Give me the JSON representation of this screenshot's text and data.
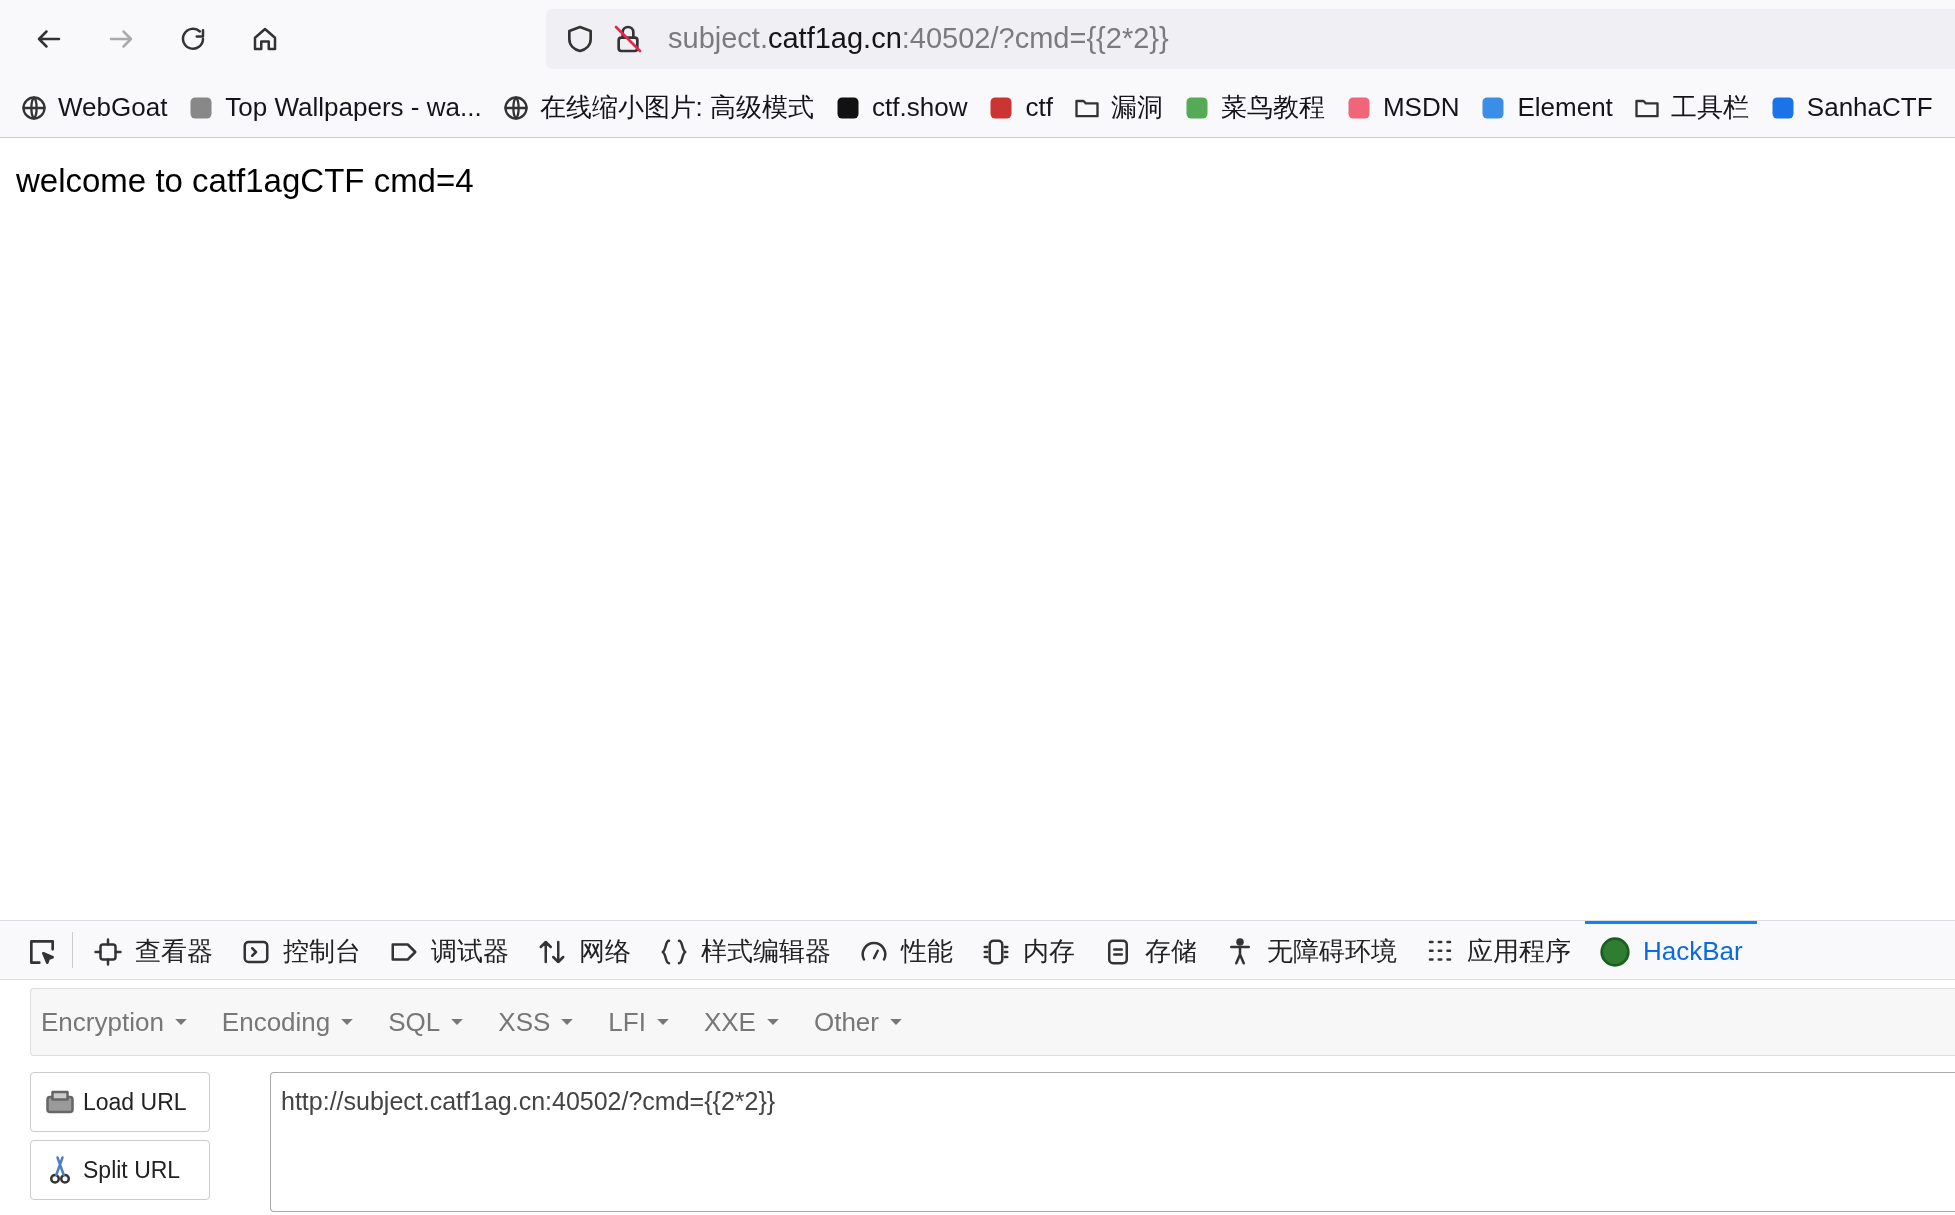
{
  "toolbar": {
    "back_enabled": true,
    "forward_enabled": false,
    "address": [
      {
        "text": "subject.",
        "strong": false
      },
      {
        "text": "catf1ag.cn",
        "strong": true
      },
      {
        "text": ":40502/?cmd={{2*2}}",
        "strong": false
      }
    ]
  },
  "bookmarks": [
    {
      "label": "WebGoat",
      "kind": "globe"
    },
    {
      "label": "Top Wallpapers - wa...",
      "kind": "site"
    },
    {
      "label": "在线缩小图片: 高级模式",
      "kind": "globe"
    },
    {
      "label": "ctf.show",
      "kind": "site"
    },
    {
      "label": "ctf",
      "kind": "site"
    },
    {
      "label": "漏洞",
      "kind": "folder"
    },
    {
      "label": "菜鸟教程",
      "kind": "site"
    },
    {
      "label": "MSDN",
      "kind": "site"
    },
    {
      "label": "Element",
      "kind": "site"
    },
    {
      "label": "工具栏",
      "kind": "folder"
    },
    {
      "label": "SanhaCTF",
      "kind": "site"
    }
  ],
  "page": {
    "text": "welcome to catf1agCTF cmd=4"
  },
  "devtools": {
    "tabs": [
      {
        "label": "查看器",
        "selected": false
      },
      {
        "label": "控制台",
        "selected": false
      },
      {
        "label": "调试器",
        "selected": false
      },
      {
        "label": "网络",
        "selected": false
      },
      {
        "label": "样式编辑器",
        "selected": false
      },
      {
        "label": "性能",
        "selected": false
      },
      {
        "label": "内存",
        "selected": false
      },
      {
        "label": "存储",
        "selected": false
      },
      {
        "label": "无障碍环境",
        "selected": false
      },
      {
        "label": "应用程序",
        "selected": false
      },
      {
        "label": "HackBar",
        "selected": true
      }
    ]
  },
  "hackbar": {
    "menus": [
      "Encryption",
      "Encoding",
      "SQL",
      "XSS",
      "LFI",
      "XXE",
      "Other"
    ],
    "buttons": [
      "Load URL",
      "Split URL"
    ],
    "url_value": "http://subject.catf1ag.cn:40502/?cmd={{2*2}}"
  }
}
